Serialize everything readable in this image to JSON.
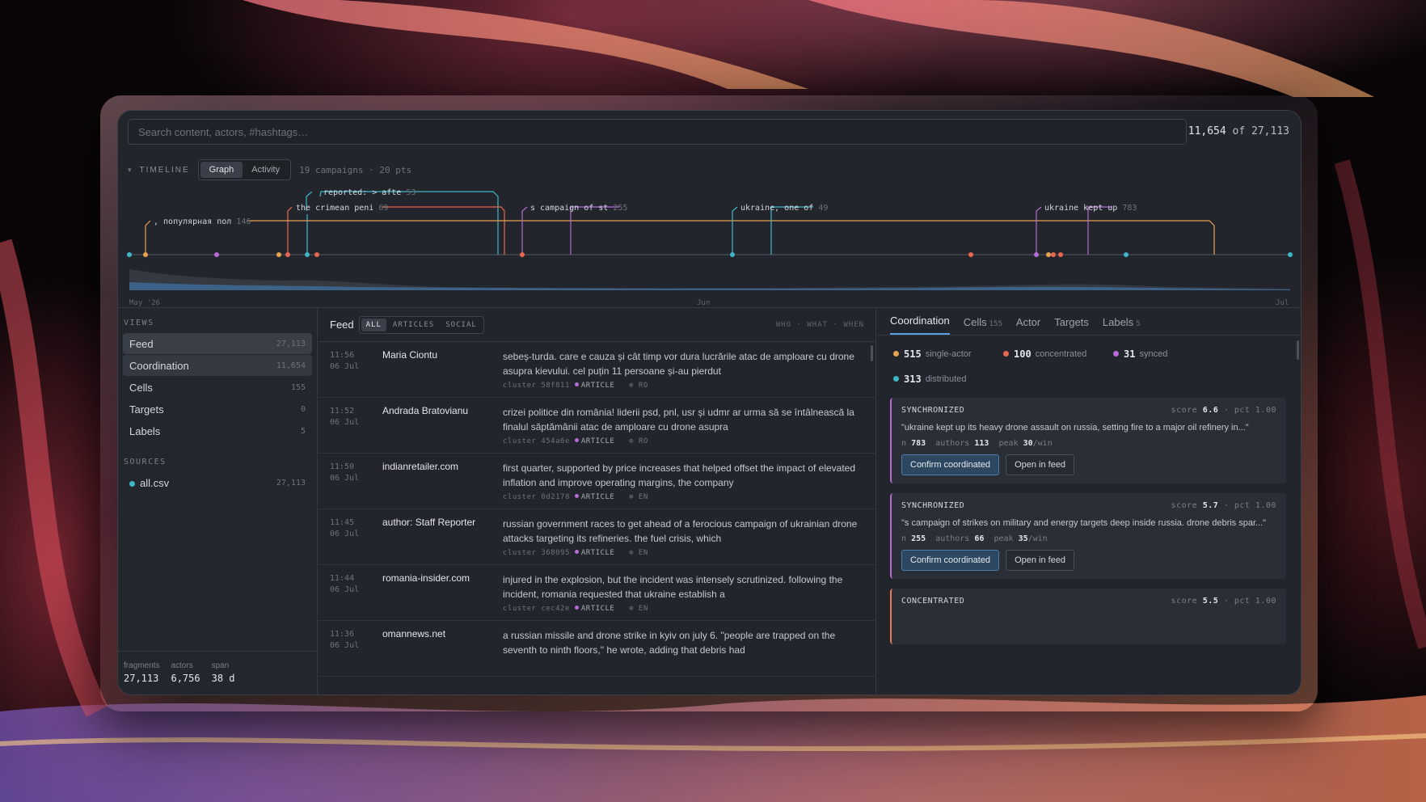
{
  "colors": {
    "purple": "#b86ad6",
    "orange": "#e87d52",
    "teal": "#3fb6c8",
    "amber": "#e8a14f",
    "accent": "#5aa0e0"
  },
  "search": {
    "placeholder": "Search content, actors, #hashtags…",
    "shown": "11,654",
    "of": "of",
    "total": "27,113"
  },
  "timeline": {
    "label": "TIMELINE",
    "modes": [
      "Graph",
      "Activity"
    ],
    "summary": "19 campaigns · 20 pts",
    "annotations": [
      {
        "text": "reported: > afte",
        "n": "53"
      },
      {
        "text": "the crimean peni",
        "n": "69"
      },
      {
        "text": ", популярная пол",
        "n": "146"
      },
      {
        "text": "s campaign of st",
        "n": "255"
      },
      {
        "text": "ukraine, one of",
        "n": "49"
      },
      {
        "text": "ukraine kept up",
        "n": "783"
      }
    ],
    "axis": [
      "May '26",
      "Jun",
      "Jul"
    ]
  },
  "sidebar": {
    "views_title": "VIEWS",
    "views": [
      {
        "label": "Feed",
        "count": "27,113"
      },
      {
        "label": "Coordination",
        "count": "11,654"
      },
      {
        "label": "Cells",
        "count": "155"
      },
      {
        "label": "Targets",
        "count": "0"
      },
      {
        "label": "Labels",
        "count": "5"
      }
    ],
    "sources_title": "SOURCES",
    "sources": [
      {
        "label": "all.csv",
        "count": "27,113"
      }
    ],
    "stats": [
      {
        "k": "fragments",
        "v": "27,113"
      },
      {
        "k": "actors",
        "v": "6,756"
      },
      {
        "k": "span",
        "v": "38 d"
      }
    ]
  },
  "feed": {
    "title": "Feed",
    "filters": [
      "ALL",
      "ARTICLES",
      "SOCIAL"
    ],
    "sort": "WHO · WHAT · WHEN",
    "rows": [
      {
        "time": "11:56",
        "date": "06 Jul",
        "author": "Maria Ciontu",
        "text": "sebeș-turda. care e cauza și cât timp vor dura lucrările atac de amploare cu drone asupra kievului. cel puțin 11 persoane și-au pierdut",
        "cluster": "cluster 58f811",
        "type": "ARTICLE",
        "lang": "⊕ RO"
      },
      {
        "time": "11:52",
        "date": "06 Jul",
        "author": "Andrada Bratovianu",
        "text": "crizei politice din românia! liderii psd, pnl, usr și udmr ar urma să se întâlnească la finalul săptămânii atac de amploare cu drone asupra",
        "cluster": "cluster 454a6e",
        "type": "ARTICLE",
        "lang": "⊕ RO"
      },
      {
        "time": "11:50",
        "date": "06 Jul",
        "author": "indianretailer.com",
        "text": "first quarter, supported by price increases that helped offset the impact of elevated inflation and improve operating margins, the company",
        "cluster": "cluster 0d2178",
        "type": "ARTICLE",
        "lang": "⊕ EN"
      },
      {
        "time": "11:45",
        "date": "06 Jul",
        "author": "author: Staff Reporter",
        "text": "russian government races to get ahead of a ferocious campaign of ukrainian drone attacks targeting its refineries. the fuel crisis, which",
        "cluster": "cluster 368095",
        "type": "ARTICLE",
        "lang": "⊕ EN"
      },
      {
        "time": "11:44",
        "date": "06 Jul",
        "author": "romania-insider.com",
        "text": "injured in the explosion, but the incident was intensely scrutinized. following the incident, romania requested that ukraine establish a",
        "cluster": "cluster cec42e",
        "type": "ARTICLE",
        "lang": "⊕ EN"
      },
      {
        "time": "11:36",
        "date": "06 Jul",
        "author": "omannews.net",
        "text": "a russian missile and drone strike in kyiv on july 6. \"people are trapped on the seventh to ninth floors,\" he wrote, adding that debris had",
        "cluster": "",
        "type": "",
        "lang": ""
      }
    ]
  },
  "right": {
    "tabs": [
      {
        "label": "Coordination",
        "n": ""
      },
      {
        "label": "Cells",
        "n": "155"
      },
      {
        "label": "Actor",
        "n": ""
      },
      {
        "label": "Targets",
        "n": ""
      },
      {
        "label": "Labels",
        "n": "5"
      }
    ],
    "legend": [
      {
        "n": "515",
        "label": "single-actor",
        "color": "#e8a14f"
      },
      {
        "n": "100",
        "label": "concentrated",
        "color": "#e8674f"
      },
      {
        "n": "31",
        "label": "synced",
        "color": "#b86ad6"
      },
      {
        "n": "313",
        "label": "distributed",
        "color": "#3fb6c8"
      }
    ],
    "cards": [
      {
        "kind": "SYNCHRONIZED",
        "score": "6.6",
        "pct": "1.00",
        "quote": "\"ukraine kept up its heavy drone assault on russia, setting fire to a major oil refinery in...\"",
        "n": "783",
        "authors": "113",
        "peak": "30",
        "confirm": "Confirm coordinated",
        "open": "Open in feed"
      },
      {
        "kind": "SYNCHRONIZED",
        "score": "5.7",
        "pct": "1.00",
        "quote": "\"s campaign of strikes on military and energy targets deep inside russia. drone debris spar...\"",
        "n": "255",
        "authors": "66",
        "peak": "35",
        "confirm": "Confirm coordinated",
        "open": "Open in feed"
      },
      {
        "kind": "CONCENTRATED",
        "score": "5.5",
        "pct": "1.00",
        "quote": "",
        "n": "",
        "authors": "",
        "peak": "",
        "confirm": "",
        "open": ""
      }
    ],
    "labels": {
      "score": "score",
      "pct": "pct",
      "n": "n",
      "authors": "authors",
      "peak": "peak",
      "per": "/win"
    }
  }
}
